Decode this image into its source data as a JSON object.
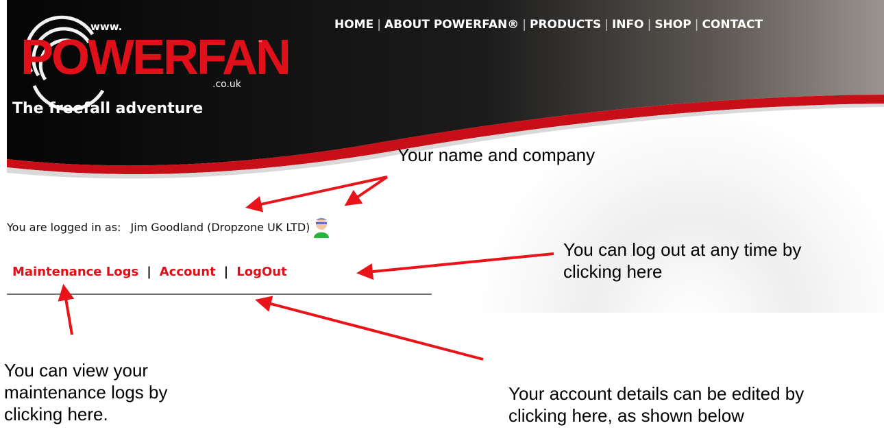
{
  "site": {
    "logo": {
      "www": "www.",
      "word": "POWERFAN",
      "tm": "™",
      "domain": ".co.uk",
      "tagline": "The freefall adventure"
    },
    "nav": [
      "HOME",
      "ABOUT POWERFAN®",
      "PRODUCTS",
      "INFO",
      "SHOP",
      "CONTACT"
    ],
    "logged_in": {
      "prefix": "You are logged in as:",
      "user": "Jim Goodland (Dropzone UK LTD)",
      "icon": "user-avatar-icon"
    },
    "subnav": [
      "Maintenance Logs",
      "Account",
      "LogOut"
    ]
  },
  "annotations": {
    "name_company": [
      "Your name and company"
    ],
    "logout": [
      "You can log out at any time by",
      "clicking here"
    ],
    "logs": [
      "You can view your",
      "maintenance logs by",
      "clicking here."
    ],
    "account": [
      "Your account details can be edited by",
      "clicking here, as shown below"
    ]
  },
  "colors": {
    "brand_red": "#e0101a",
    "header_dark": "#0a0a0a",
    "arrow": "#e8141a"
  }
}
